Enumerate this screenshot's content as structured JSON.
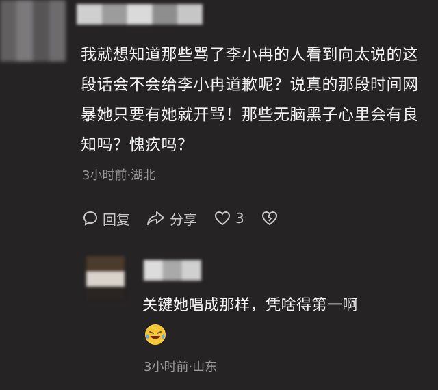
{
  "comment": {
    "text": "我就想知道那些骂了李小冉的人看到向太说的这段话会不会给李小冉道歉呢？说真的那段时间网暴她只要有她就开骂！那些无脑黑子心里会有良知吗？愧疚吗？",
    "meta": "3小时前·湖北",
    "actions": {
      "reply_label": "回复",
      "share_label": "分享",
      "like_count": "3"
    }
  },
  "reply": {
    "text": "关键她唱成那样，凭啥得第一啊",
    "emoji": "laughing-crying",
    "meta": "3小时前·山东"
  },
  "colors": {
    "background": "#252324",
    "text": "#f3f3f3",
    "muted": "#9a9899"
  }
}
